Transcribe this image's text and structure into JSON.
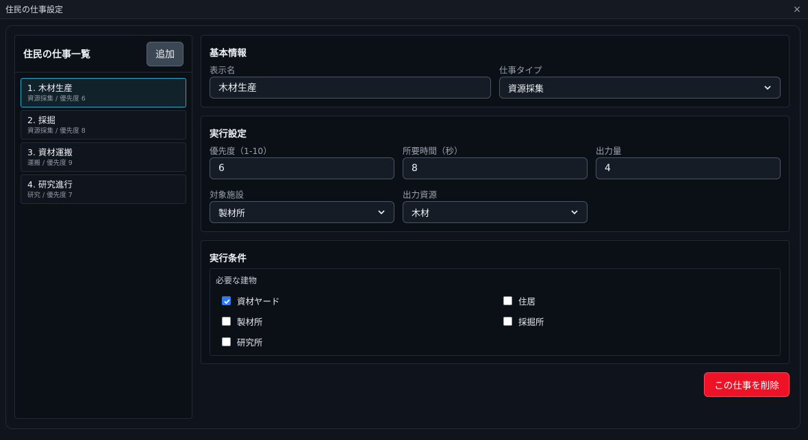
{
  "window": {
    "title": "住民の仕事設定",
    "close_glyph": "×"
  },
  "sidebar": {
    "heading": "住民の仕事一覧",
    "add_label": "追加",
    "items": [
      {
        "name": "1. 木材生産",
        "sub": "資源採集 / 優先度 6",
        "selected": true
      },
      {
        "name": "2. 採掘",
        "sub": "資源採集 / 優先度 8",
        "selected": false
      },
      {
        "name": "3. 資材運搬",
        "sub": "運搬 / 優先度 9",
        "selected": false
      },
      {
        "name": "4. 研究進行",
        "sub": "研究 / 優先度 7",
        "selected": false
      }
    ]
  },
  "basic": {
    "heading": "基本情報",
    "display_name_label": "表示名",
    "display_name_value": "木材生産",
    "job_type_label": "仕事タイプ",
    "job_type_value": "資源採集"
  },
  "exec": {
    "heading": "実行設定",
    "priority_label": "優先度（1-10）",
    "priority_value": "6",
    "duration_label": "所要時間（秒）",
    "duration_value": "8",
    "output_amount_label": "出力量",
    "output_amount_value": "4",
    "facility_label": "対象施設",
    "facility_value": "製材所",
    "resource_label": "出力資源",
    "resource_value": "木材"
  },
  "conditions": {
    "heading": "実行条件",
    "required_label": "必要な建物",
    "buildings": [
      {
        "label": "資材ヤード",
        "checked": true
      },
      {
        "label": "住居",
        "checked": false
      },
      {
        "label": "製材所",
        "checked": false
      },
      {
        "label": "採掘所",
        "checked": false
      },
      {
        "label": "研究所",
        "checked": false
      }
    ]
  },
  "actions": {
    "delete_label": "この仕事を削除"
  },
  "colors": {
    "accent": "#2aa7c9",
    "danger": "#ee1226",
    "check": "#2f7bf5"
  }
}
